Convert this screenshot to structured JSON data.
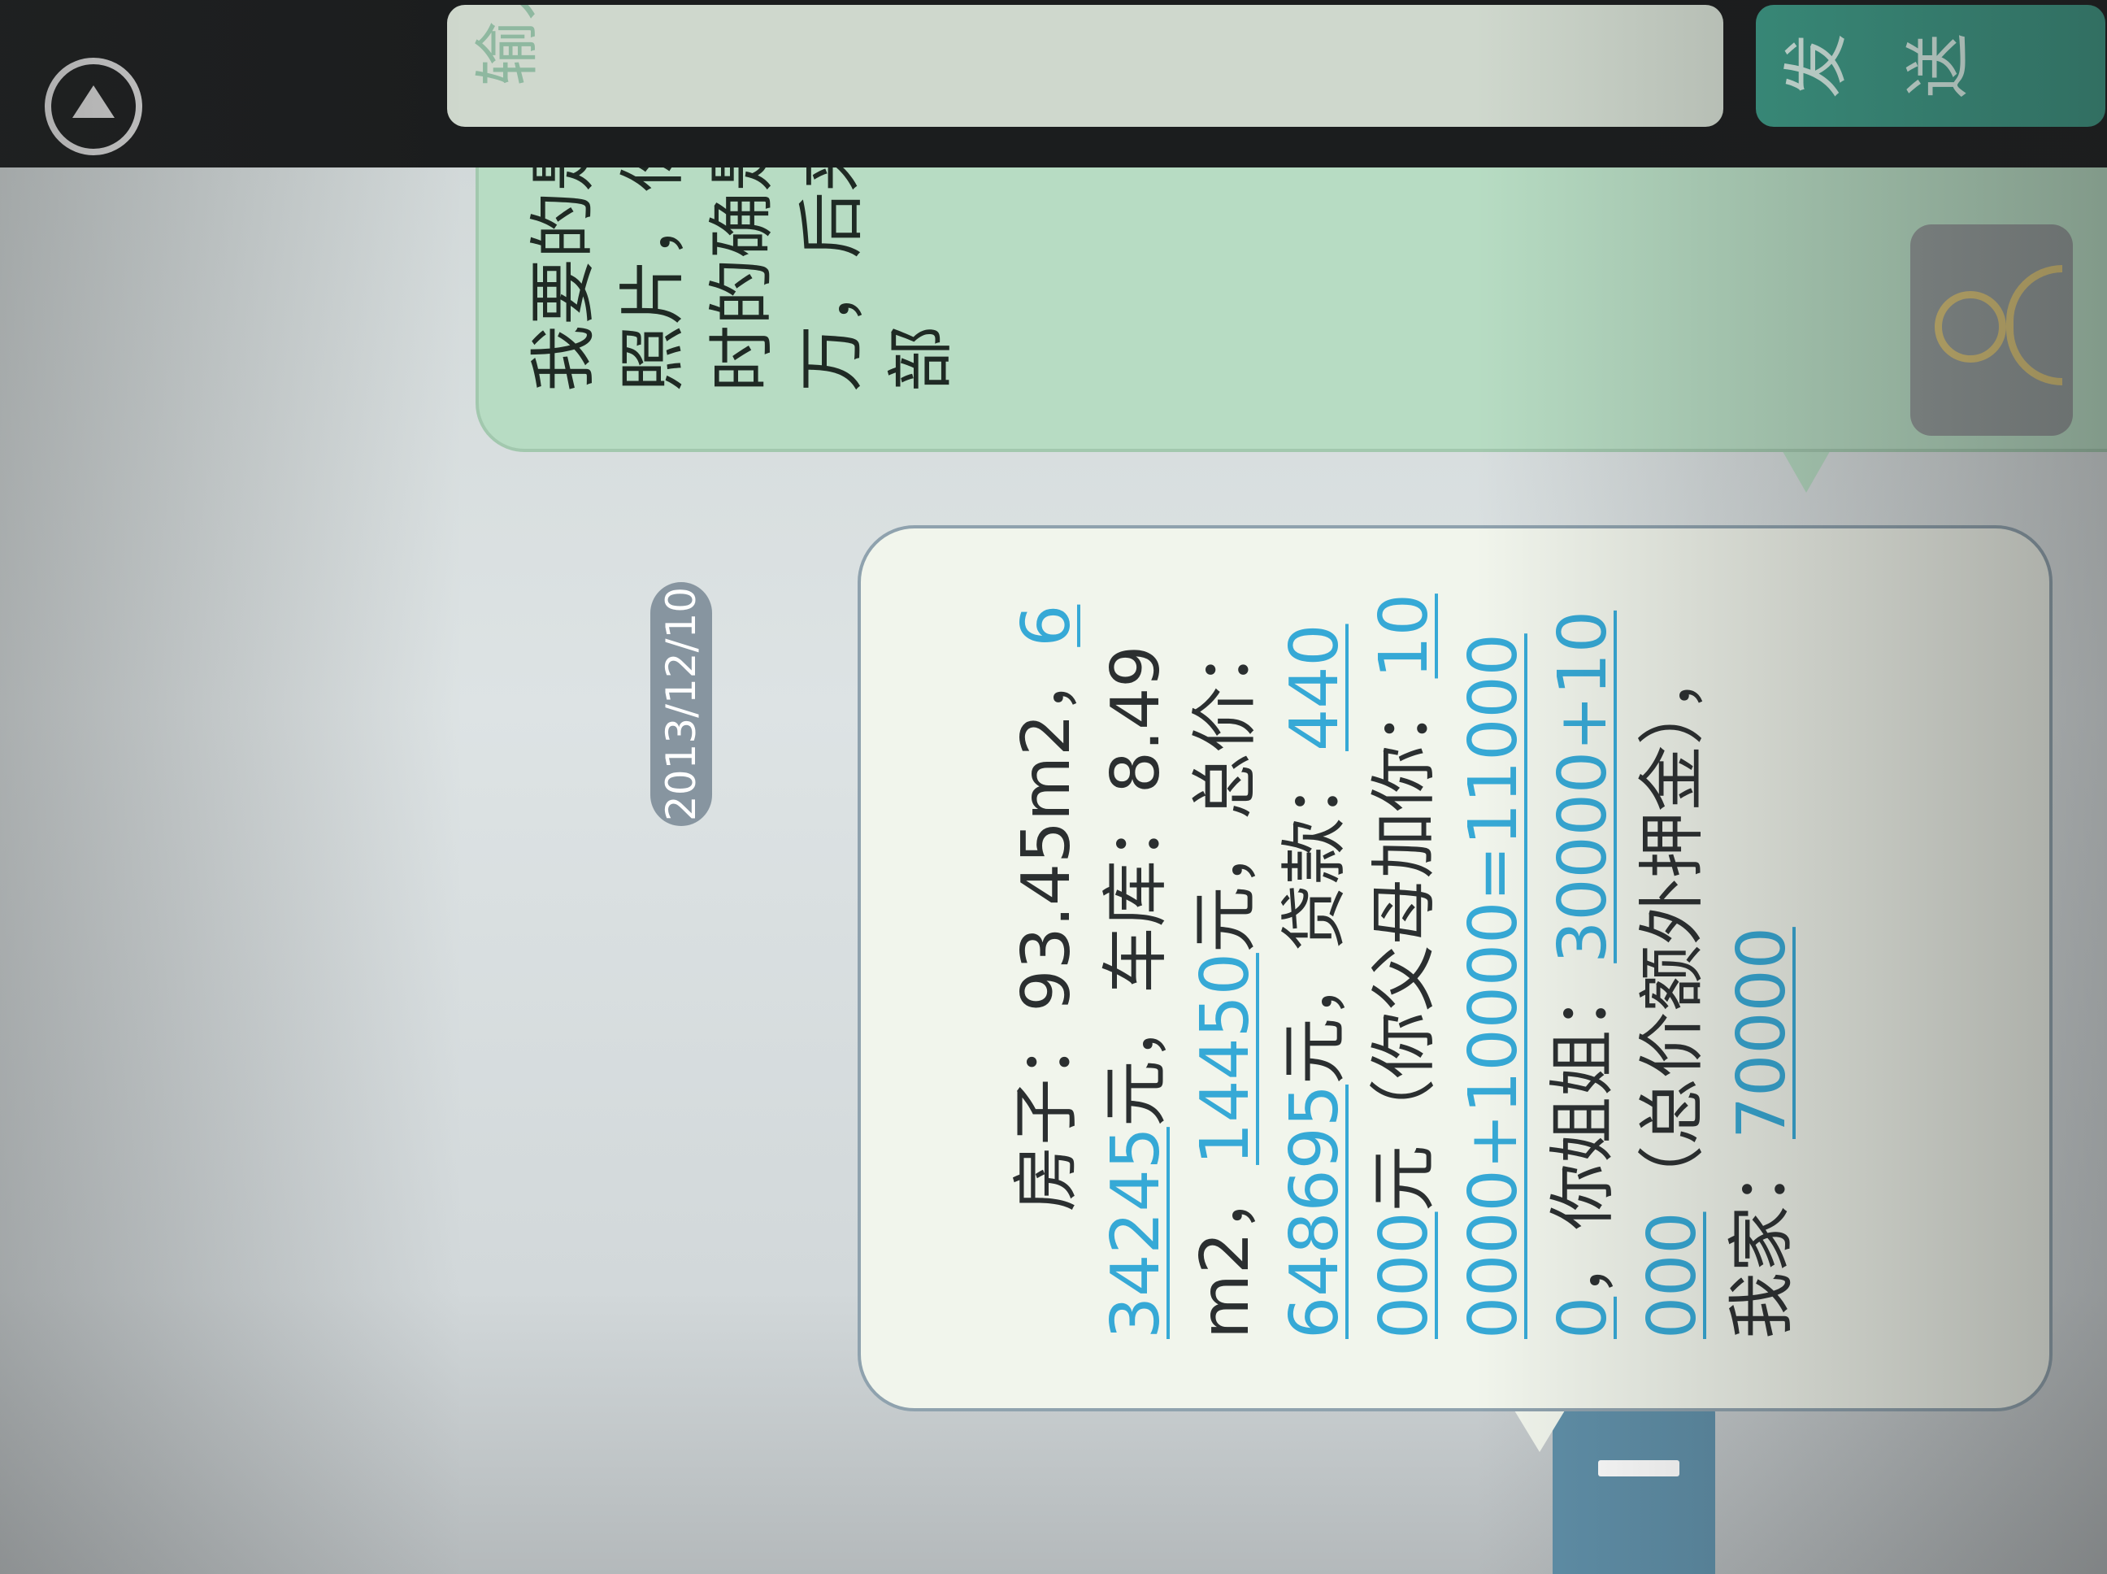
{
  "conversation": {
    "date_separator": "2013/12/10"
  },
  "incoming_message": {
    "lines": [
      [
        "房子：93.45m2，",
        {
          "num": "634245"
        },
        "元，车库：8.49m2，",
        {
          "num": "14450"
        },
        "元，总价：",
        {
          "num": "648695"
        },
        "元，贷款：",
        {
          "num": "440000"
        },
        "元（你父母加你：",
        {
          "num": "100000+10000=110000"
        },
        "，你姐姐：",
        {
          "num": "30000+10000"
        },
        "（总价额外押金），我家：",
        {
          "num": "70000"
        }
      ]
    ],
    "segments": [
      {
        "text": "房子：93.45m2，",
        "link": false
      },
      {
        "text": "634245",
        "link": true
      },
      {
        "text": "元，车库：8.49m2，",
        "link": false
      },
      {
        "text": "14450",
        "link": true
      },
      {
        "text": "元，总价：",
        "link": false
      },
      {
        "text": "648695",
        "link": true
      },
      {
        "text": "元，贷款：",
        "link": false
      },
      {
        "text": "440000",
        "link": true
      },
      {
        "text": "元（你父母加你：",
        "link": false
      },
      {
        "text": "100000+10000=11000",
        "link": true
      },
      {
        "text": "0",
        "link": true
      },
      {
        "text": "，你姐姐：",
        "link": false
      },
      {
        "text": "30000+10000",
        "link": true
      },
      {
        "text": "（总价额外押金），我家：",
        "link": false
      },
      {
        "text": "70000",
        "link": true
      }
    ]
  },
  "outgoing_message": {
    "text": "我要的是发票照片，你家当时的确是四万，后来差的部"
  },
  "compose": {
    "placeholder": "输入短信内容",
    "send_label": "发送"
  },
  "colors": {
    "link": "#36a9d6",
    "incoming_bubble": "#f1f5ec",
    "outgoing_bubble": "#b7dcc3",
    "send_button": "#3c9a86",
    "date_pill": "#8795a0"
  },
  "icons": {
    "contact": "contact-person-icon",
    "play": "play-circle-icon"
  }
}
